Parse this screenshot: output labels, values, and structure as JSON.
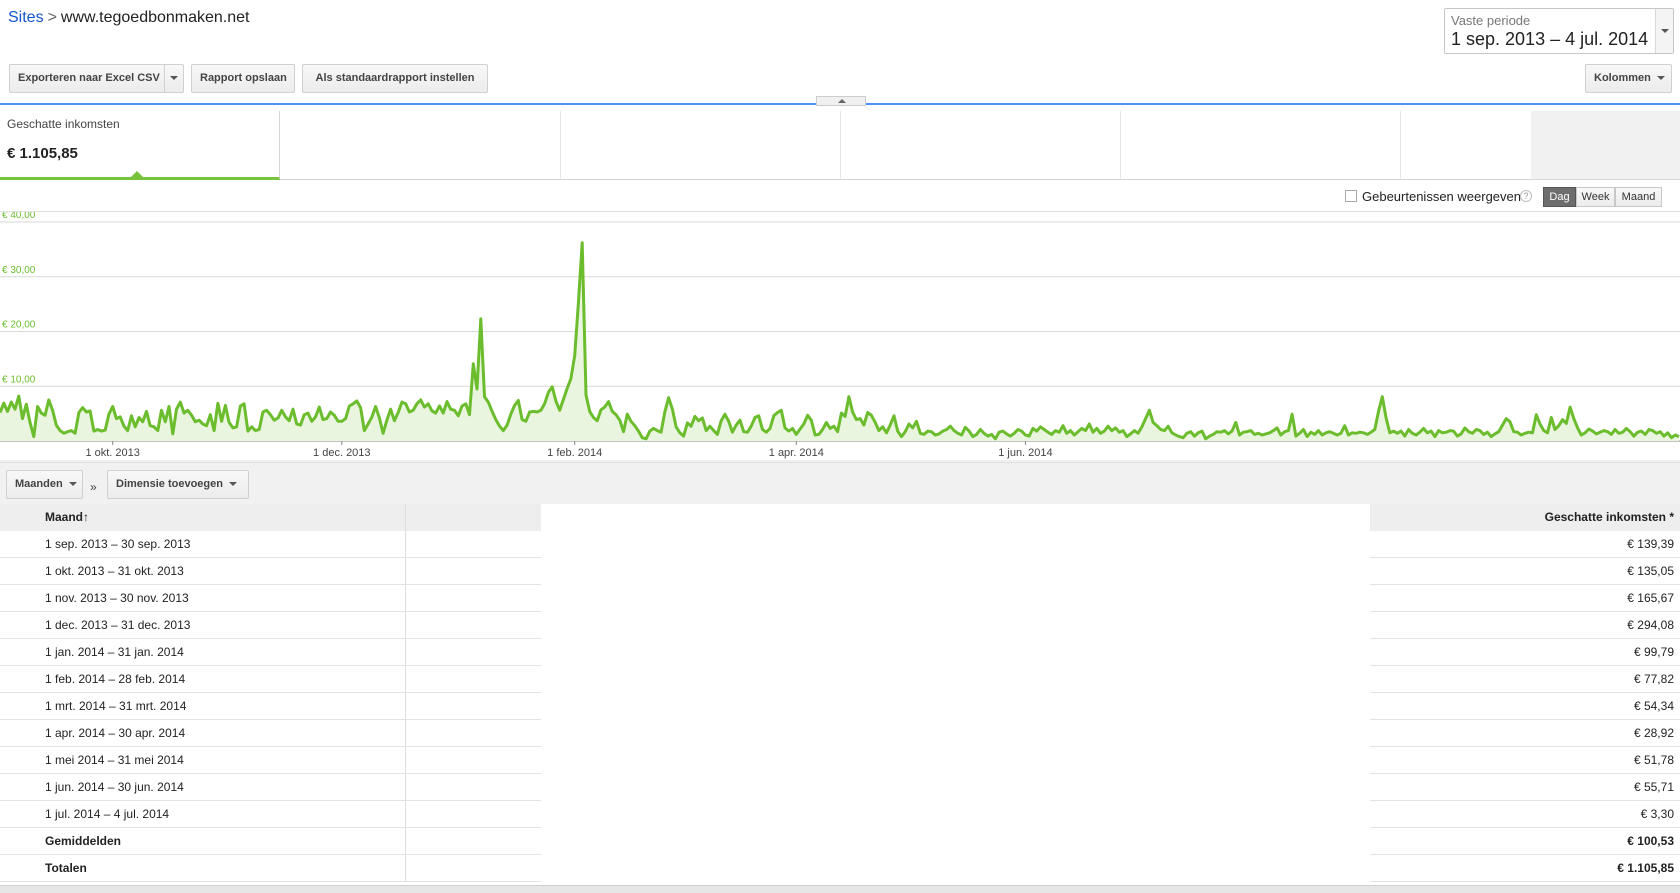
{
  "breadcrumb": {
    "root": "Sites",
    "separator": ">",
    "current": "www.tegoedbonmaken.net"
  },
  "date_range": {
    "label": "Vaste periode",
    "value": "1 sep. 2013 – 4 jul. 2014"
  },
  "toolbar": {
    "export_label": "Exporteren naar Excel CSV",
    "save_label": "Rapport opslaan",
    "default_label": "Als standaardrapport instellen",
    "columns_label": "Kolommen"
  },
  "scorecard": {
    "label": "Geschatte inkomsten",
    "value": "€ 1.105,85"
  },
  "chart_options": {
    "events_label": "Gebeurtenissen weergeven",
    "help": "?",
    "periods": [
      "Dag",
      "Week",
      "Maand"
    ],
    "active_period": "Dag"
  },
  "chart_data": {
    "type": "area",
    "series": [
      {
        "values": [
          5.2,
          6.9,
          5.4,
          7.1,
          5.8,
          8.2,
          4.1,
          6.7,
          3.4,
          0.8,
          6.3,
          5.1,
          4.7,
          7.5,
          5.6,
          2.9,
          1.9,
          1.4,
          1.7,
          1.9,
          1.4,
          5.2,
          6.1,
          5.3,
          5.5,
          1.8,
          2.1,
          1.8,
          2.0,
          4.9,
          6.3,
          4.1,
          4.4,
          2.7,
          1.9,
          4.6,
          2.6,
          4.3,
          3.5,
          5.4,
          2.8,
          2.6,
          1.9,
          5.6,
          3.5,
          6.3,
          1.3,
          5.8,
          7.1,
          5.1,
          5.6,
          4.7,
          3.5,
          3.8,
          3.1,
          2.8,
          4.8,
          1.9,
          6.9,
          3.6,
          6.5,
          3.4,
          2.4,
          2.6,
          6.4,
          6.8,
          1.8,
          2.6,
          1.9,
          2.1,
          5.3,
          5.6,
          4.8,
          3.8,
          4.2,
          5.6,
          4.4,
          3.7,
          5.8,
          3.1,
          2.9,
          4.8,
          5.1,
          3.6,
          4.4,
          6.2,
          3.9,
          4.1,
          5.3,
          4.7,
          3.6,
          3.6,
          4.1,
          6.4,
          6.8,
          7.3,
          6.1,
          1.9,
          3.1,
          4.4,
          6.3,
          4.2,
          1.4,
          3.8,
          5.8,
          3.7,
          5.2,
          7.1,
          6.8,
          5.3,
          5.6,
          6.8,
          7.5,
          6.2,
          6.8,
          5.5,
          5.1,
          6.4,
          5.1,
          7.2,
          5.8,
          5.6,
          4.6,
          6.4,
          6.8,
          4.8,
          14.1,
          9.5,
          22.3,
          8.1,
          7.1,
          5.4,
          3.9,
          2.7,
          1.9,
          2.9,
          4.9,
          6.5,
          7.4,
          3.9,
          3.6,
          5.3,
          5.4,
          5.3,
          5.6,
          6.8,
          8.9,
          9.9,
          7.3,
          5.6,
          7.6,
          9.6,
          11.4,
          15.6,
          25.2,
          36.2,
          8.4,
          5.4,
          4.3,
          3.7,
          5.7,
          6.2,
          7.2,
          5.4,
          4.8,
          3.8,
          1.7,
          4.9,
          3.6,
          2.8,
          1.8,
          0.6,
          0.4,
          1.8,
          2.3,
          1.9,
          1.6,
          5.3,
          7.9,
          5.8,
          2.6,
          1.5,
          0.9,
          3.3,
          2.7,
          4.5,
          3.7,
          4.2,
          1.9,
          2.7,
          1.9,
          1.2,
          3.7,
          4.9,
          3.6,
          1.6,
          2.9,
          3.8,
          1.7,
          1.6,
          2.7,
          4.3,
          4.6,
          2.1,
          1.6,
          2.3,
          4.6,
          5.2,
          5.6,
          2.4,
          1.8,
          2.3,
          1.2,
          2.2,
          3.1,
          4.7,
          3.8,
          1.1,
          1.2,
          2.1,
          3.4,
          2.3,
          2.7,
          1.7,
          5.1,
          4.5,
          8.1,
          5.3,
          3.9,
          4.1,
          2.9,
          5.2,
          4.7,
          3.4,
          1.9,
          2.6,
          1.5,
          2.9,
          4.6,
          1.8,
          0.8,
          1.7,
          3.1,
          2.4,
          3.6,
          1.4,
          1.2,
          1.8,
          1.7,
          1.1,
          1.3,
          1.8,
          2.1,
          2.7,
          1.9,
          1.4,
          1.1,
          2.5,
          1.8,
          0.8,
          1.2,
          2.1,
          1.4,
          0.9,
          1.2,
          0.4,
          1.6,
          1.8,
          1.3,
          0.9,
          1.4,
          2.1,
          1.8,
          1.1,
          0.9,
          2.3,
          1.8,
          2.6,
          2.1,
          1.6,
          1.2,
          1.9,
          1.6,
          2.8,
          1.4,
          1.9,
          1.1,
          1.7,
          2.3,
          1.9,
          3.1,
          1.6,
          2.3,
          1.4,
          1.8,
          2.7,
          1.9,
          2.4,
          1.6,
          1.9,
          0.8,
          1.3,
          1.9,
          1.4,
          2.6,
          4.1,
          5.6,
          3.4,
          2.8,
          2.1,
          1.9,
          2.7,
          1.5,
          1.1,
          0.8,
          0.6,
          1.4,
          1.7,
          0.9,
          1.5,
          1.8,
          0.4,
          0.9,
          1.2,
          1.7,
          1.6,
          1.9,
          1.3,
          1.8,
          3.4,
          1.1,
          1.6,
          1.7,
          1.9,
          1.2,
          1.4,
          1.1,
          1.3,
          1.5,
          1.9,
          2.4,
          1.1,
          1.7,
          1.9,
          4.9,
          0.9,
          1.4,
          2.1,
          0.8,
          1.6,
          1.2,
          1.9,
          1.1,
          1.5,
          1.7,
          1.4,
          1.1,
          1.4,
          2.8,
          1.1,
          1.5,
          1.4,
          1.6,
          1.5,
          1.2,
          1.6,
          2.1,
          5.4,
          8.1,
          4.3,
          1.5,
          1.8,
          1.4,
          1.8,
          0.9,
          2.1,
          1.4,
          1.1,
          1.6,
          2.3,
          1.5,
          1.8,
          0.8,
          1.9,
          1.5,
          1.6,
          1.9,
          1.8,
          0.9,
          1.3,
          2.4,
          1.7,
          1.4,
          2.1,
          1.9,
          1.2,
          1.6,
          0.8,
          1.3,
          1.7,
          2.9,
          4.1,
          3.5,
          1.7,
          1.6,
          1.1,
          1.4,
          1.6,
          1.5,
          4.8,
          3.1,
          1.9,
          1.5,
          4.3,
          2.1,
          2.8,
          3.9,
          3.2,
          6.2,
          4.1,
          2.4,
          1.1,
          1.5,
          2.2,
          1.8,
          1.3,
          1.6,
          1.9,
          1.7,
          1.2,
          2.1,
          1.4,
          1.6,
          2.3,
          1.7,
          0.9,
          1.6,
          1.8,
          1.2,
          2.1,
          1.9,
          1.4,
          1.7,
          0.9,
          1.5,
          0.6,
          1.1,
          0.8
        ]
      }
    ],
    "x_ticks": [
      "1 okt. 2013",
      "1 dec. 2013",
      "1 feb. 2014",
      "1 apr. 2014",
      "1 jun. 2014"
    ],
    "x_tick_positions": [
      30,
      91,
      153,
      212,
      273
    ],
    "y_ticks": [
      "€ 40,00",
      "€ 30,00",
      "€ 20,00",
      "€ 10,00"
    ],
    "y_tick_values": [
      40,
      30,
      20,
      10
    ],
    "ylim": [
      0,
      40
    ],
    "grid": true,
    "colors": {
      "line": "#6cbd2d",
      "fill": "#e9f5df",
      "axis_label": "#6cbd2d",
      "grid": "#d9d9d9"
    }
  },
  "dimension_bar": {
    "primary_label": "Maanden",
    "separator": "»",
    "add_label": "Dimensie toevoegen"
  },
  "table": {
    "columns": [
      "Maand",
      "Geschatte inkomsten *"
    ],
    "sort_indicator": "↑",
    "rows": [
      [
        "1 sep. 2013 – 30 sep. 2013",
        "€ 139,39"
      ],
      [
        "1 okt. 2013 – 31 okt. 2013",
        "€ 135,05"
      ],
      [
        "1 nov. 2013 – 30 nov. 2013",
        "€ 165,67"
      ],
      [
        "1 dec. 2013 – 31 dec. 2013",
        "€ 294,08"
      ],
      [
        "1 jan. 2014 – 31 jan. 2014",
        "€ 99,79"
      ],
      [
        "1 feb. 2014 – 28 feb. 2014",
        "€ 77,82"
      ],
      [
        "1 mrt. 2014 – 31 mrt. 2014",
        "€ 54,34"
      ],
      [
        "1 apr. 2014 – 30 apr. 2014",
        "€ 28,92"
      ],
      [
        "1 mei 2014 – 31 mei 2014",
        "€ 51,78"
      ],
      [
        "1 jun. 2014 – 30 jun. 2014",
        "€ 55,71"
      ],
      [
        "1 jul. 2014 – 4 jul. 2014",
        "€ 3,30"
      ]
    ],
    "average": {
      "label": "Gemiddelden",
      "value": "€ 100,53"
    },
    "total": {
      "label": "Totalen",
      "value": "€ 1.105,85"
    }
  }
}
